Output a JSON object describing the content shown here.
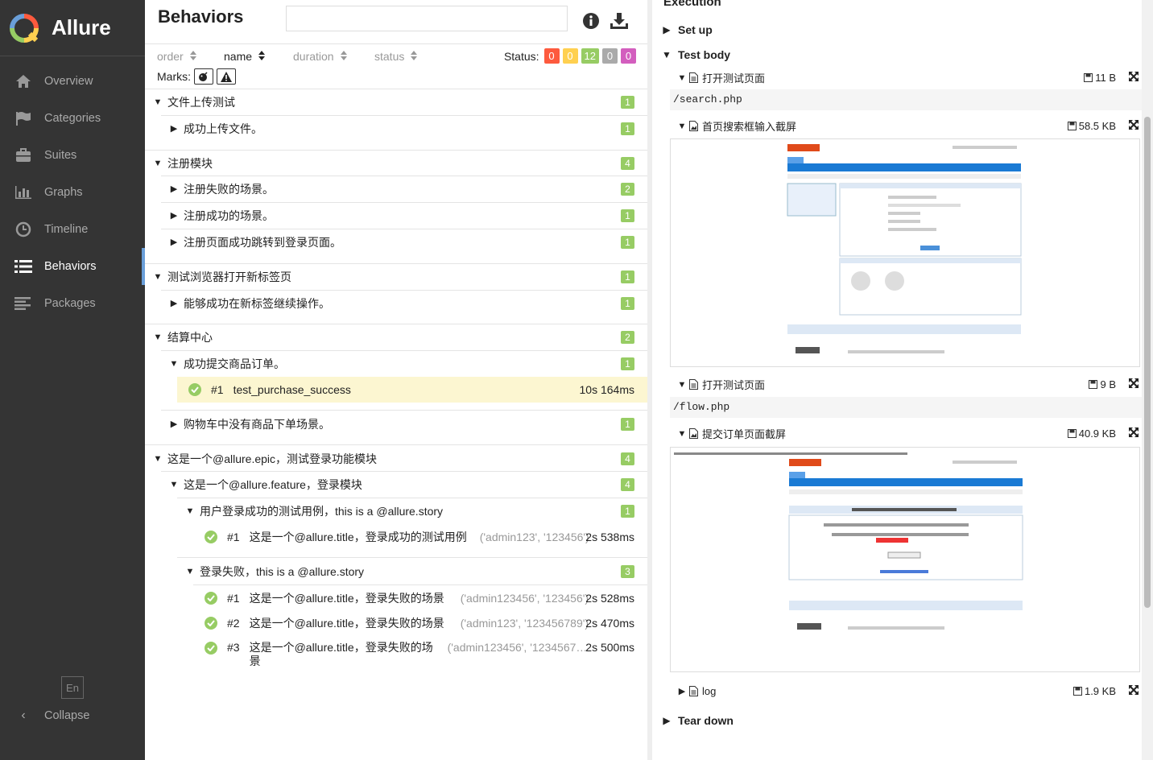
{
  "app": {
    "name": "Allure"
  },
  "nav": [
    {
      "label": "Overview",
      "icon": "home-icon"
    },
    {
      "label": "Categories",
      "icon": "flag-icon"
    },
    {
      "label": "Suites",
      "icon": "briefcase-icon"
    },
    {
      "label": "Graphs",
      "icon": "bar-chart-icon"
    },
    {
      "label": "Timeline",
      "icon": "clock-icon"
    },
    {
      "label": "Behaviors",
      "icon": "list-icon",
      "active": true
    },
    {
      "label": "Packages",
      "icon": "align-left-icon"
    }
  ],
  "lang": "En",
  "collapse": "Collapse",
  "behaviors": {
    "title": "Behaviors",
    "search_value": "",
    "sort": {
      "order": "order",
      "name": "name",
      "duration": "duration",
      "status": "status"
    },
    "status_label": "Status:",
    "status_counts": {
      "failed": "0",
      "broken": "0",
      "passed": "12",
      "skipped": "0",
      "unknown": "0"
    },
    "marks_label": "Marks:"
  },
  "tree": {
    "g1": {
      "name": "文件上传测试",
      "count": "1"
    },
    "g1s1": {
      "name": "成功上传文件。",
      "count": "1"
    },
    "g2": {
      "name": "注册模块",
      "count": "4"
    },
    "g2s1": {
      "name": "注册失败的场景。",
      "count": "2"
    },
    "g2s2": {
      "name": "注册成功的场景。",
      "count": "1"
    },
    "g2s3": {
      "name": "注册页面成功跳转到登录页面。",
      "count": "1"
    },
    "g3": {
      "name": "测试浏览器打开新标签页",
      "count": "1"
    },
    "g3s1": {
      "name": "能够成功在新标签继续操作。",
      "count": "1"
    },
    "g4": {
      "name": "结算中心",
      "count": "2"
    },
    "g4s1": {
      "name": "成功提交商品订单。",
      "count": "1"
    },
    "g4s1t1": {
      "num": "#1",
      "name": "test_purchase_success",
      "duration": "10s 164ms"
    },
    "g4s2": {
      "name": "购物车中没有商品下单场景。",
      "count": "1"
    },
    "g5": {
      "name": "这是一个@allure.epic，测试登录功能模块",
      "count": "4"
    },
    "g5f1": {
      "name": "这是一个@allure.feature，登录模块",
      "count": "4"
    },
    "g5f1s1": {
      "name": "用户登录成功的测试用例，this is a @allure.story",
      "count": "1"
    },
    "g5f1s1t1": {
      "num": "#1",
      "name": "这是一个@allure.title，登录成功的测试用例",
      "params": "('admin123', '123456')",
      "duration": "2s 538ms"
    },
    "g5f1s2": {
      "name": "登录失败，this is a @allure.story",
      "count": "3"
    },
    "g5f1s2t1": {
      "num": "#1",
      "name": "这是一个@allure.title，登录失败的场景",
      "params": "('admin123456', '123456')",
      "duration": "2s 528ms"
    },
    "g5f1s2t2": {
      "num": "#2",
      "name": "这是一个@allure.title，登录失败的场景",
      "params": "('admin123', '123456789')",
      "duration": "2s 470ms"
    },
    "g5f1s2t3": {
      "num": "#3",
      "name_l1": "这是一个@allure.title，登录失败的场",
      "name_l2": "景",
      "params": "('admin123456', '1234567…",
      "duration": "2s 500ms"
    }
  },
  "execution": {
    "title": "Execution",
    "setup": "Set up",
    "body": "Test body",
    "teardown": "Tear down",
    "attachments": {
      "a1": {
        "name": "打开测试页面",
        "size": "11 B",
        "content": "/search.php"
      },
      "a2": {
        "name": "首页搜索框输入截屏",
        "size": "58.5 KB"
      },
      "a3": {
        "name": "打开测试页面",
        "size": "9 B",
        "content": "/flow.php"
      },
      "a4": {
        "name": "提交订单页面截屏",
        "size": "40.9 KB"
      },
      "a5": {
        "name": "log",
        "size": "1.9 KB"
      }
    }
  },
  "colors": {
    "passed": "#97cc64",
    "failed": "#fd5a3e",
    "broken": "#ffd050",
    "skipped": "#aaaaaa",
    "unknown": "#d35ebe",
    "selected_row": "#fcf6d1"
  }
}
